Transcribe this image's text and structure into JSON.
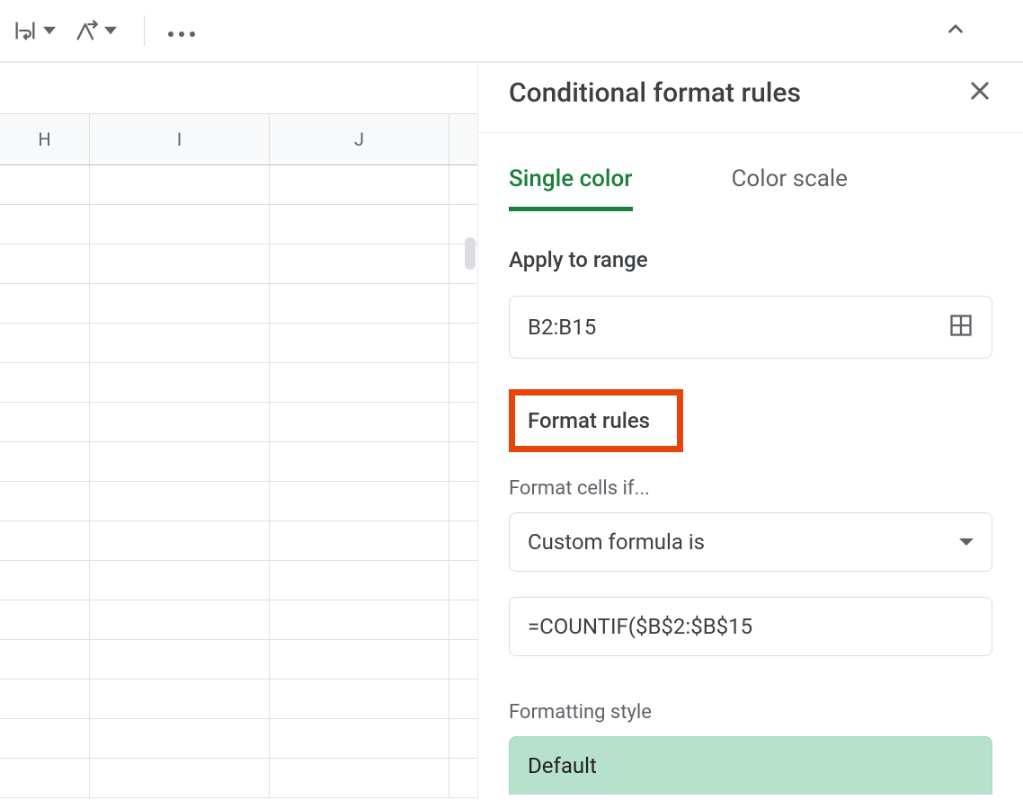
{
  "toolbar": {
    "more_icon": "…"
  },
  "columns": [
    "H",
    "I",
    "J"
  ],
  "panel": {
    "title": "Conditional format rules",
    "tabs": {
      "single": "Single color",
      "scale": "Color scale"
    },
    "apply_label": "Apply to range",
    "range_value": "B2:B15",
    "format_rules_label": "Format rules",
    "format_cells_label": "Format cells if...",
    "condition_select": "Custom formula is",
    "formula_value": "=COUNTIF($B$2:$B$15",
    "style_label": "Formatting style",
    "style_preview": "Default"
  }
}
